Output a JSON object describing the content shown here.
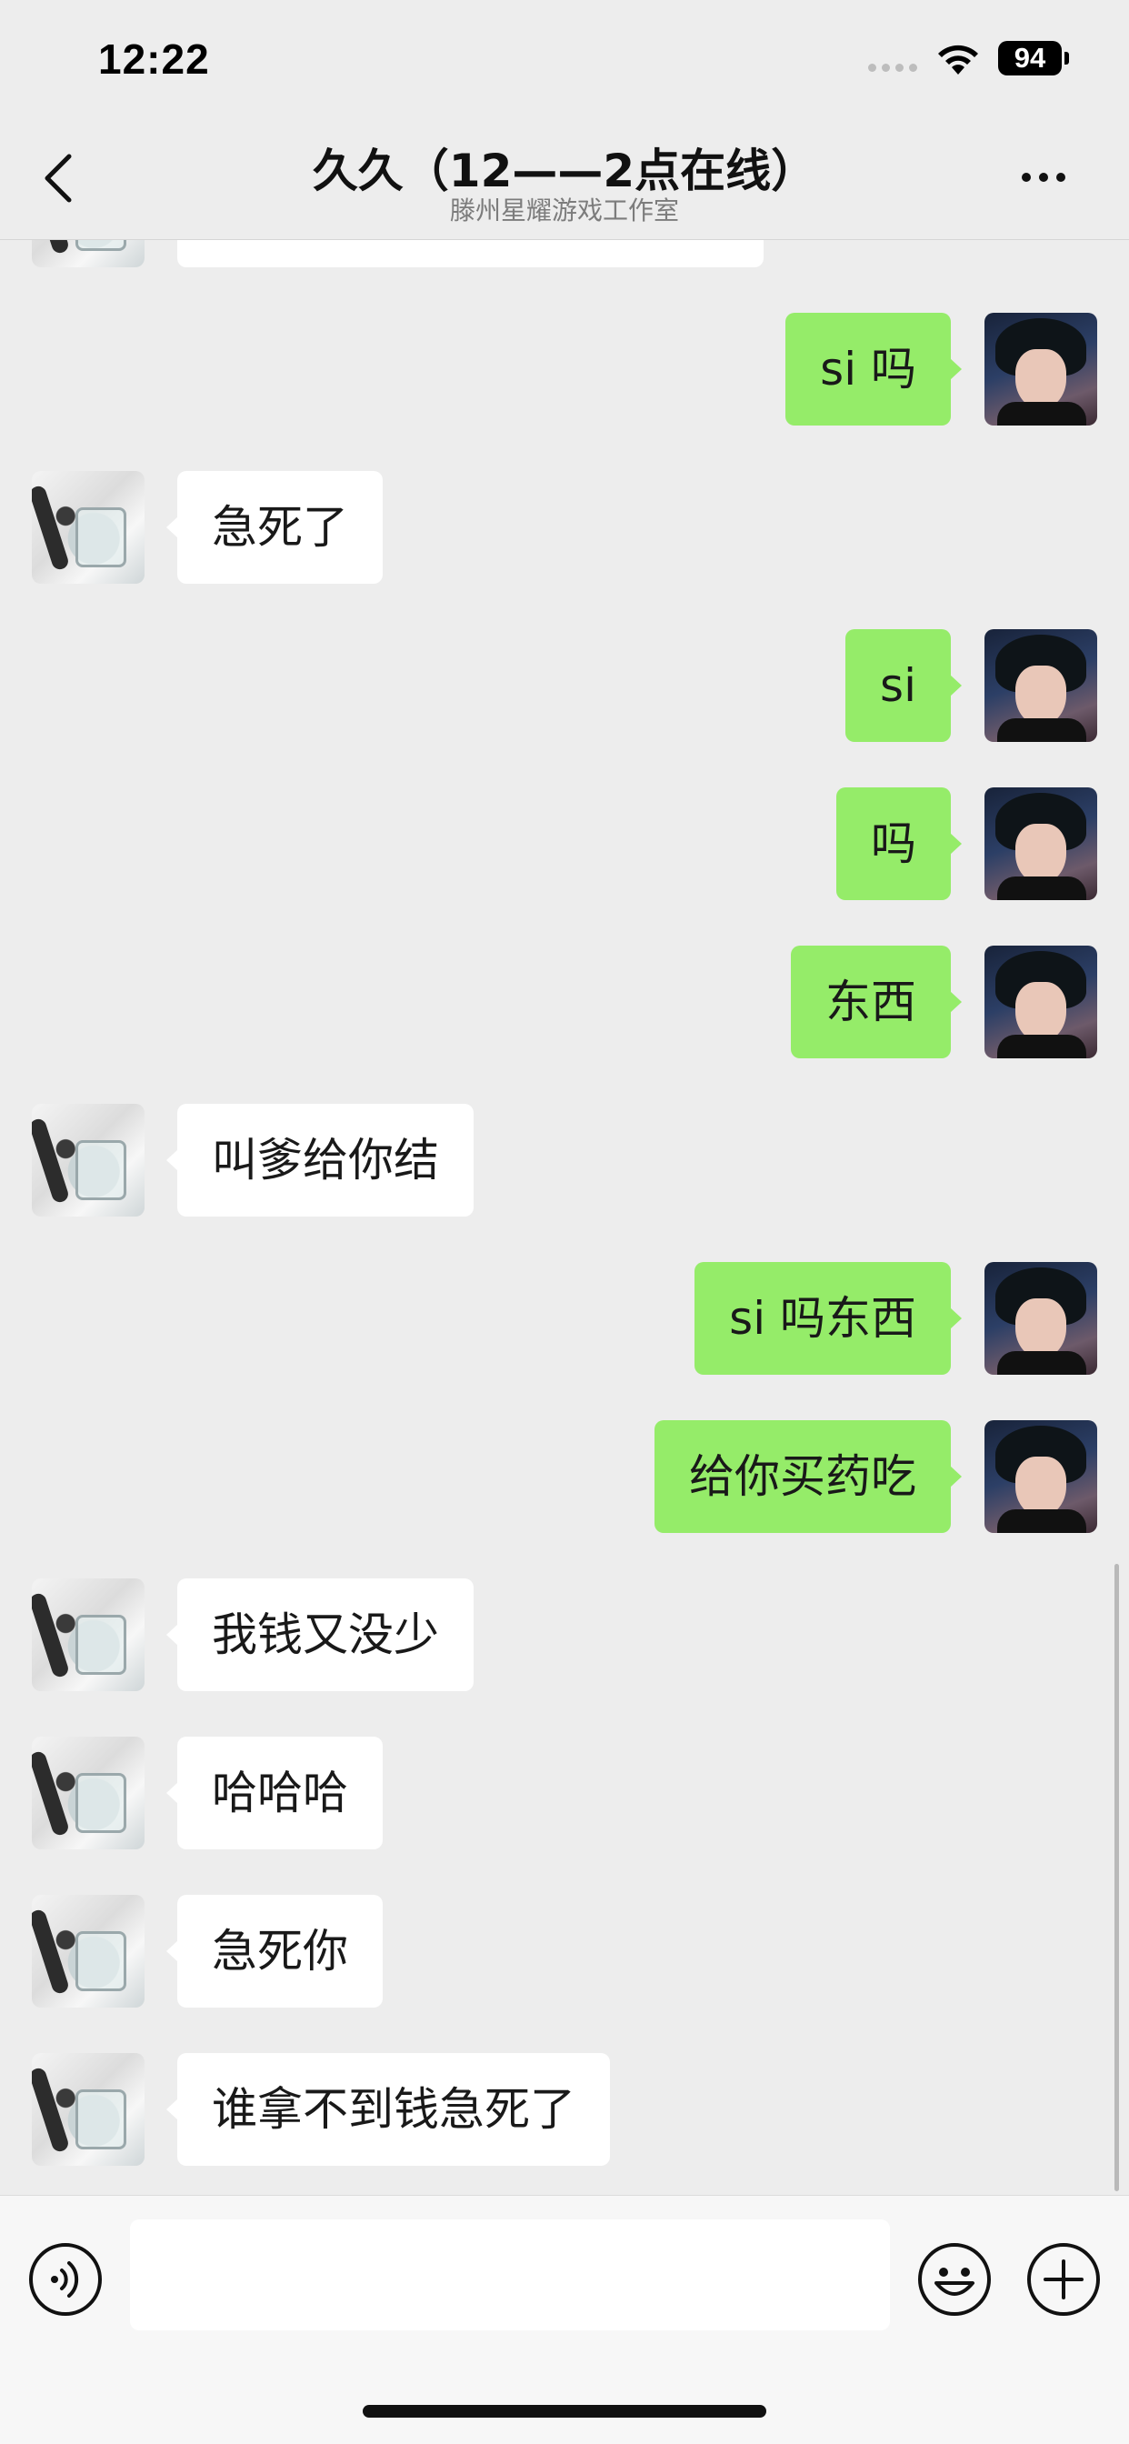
{
  "status_bar": {
    "time": "12:22",
    "battery": "94"
  },
  "header": {
    "title": "久久（12——2点在线）",
    "subtitle": "滕州星耀游戏工作室"
  },
  "messages": [
    {
      "side": "right",
      "text": "si 吗"
    },
    {
      "side": "left",
      "text": "急死了"
    },
    {
      "side": "right",
      "text": "si"
    },
    {
      "side": "right",
      "text": "吗"
    },
    {
      "side": "right",
      "text": "东西"
    },
    {
      "side": "left",
      "text": "叫爹给你结"
    },
    {
      "side": "right",
      "text": "si 吗东西"
    },
    {
      "side": "right",
      "text": "给你买药吃"
    },
    {
      "side": "left",
      "text": "我钱又没少"
    },
    {
      "side": "left",
      "text": "哈哈哈"
    },
    {
      "side": "left",
      "text": "急死你"
    },
    {
      "side": "left",
      "text": "谁拿不到钱急死了"
    }
  ],
  "input": {
    "value": "",
    "placeholder": ""
  },
  "icons": {
    "back": "chevron-left-icon",
    "more": "more-dots-icon",
    "voice": "voice-icon",
    "emoji": "emoji-icon",
    "plus": "plus-circle-icon",
    "wifi": "wifi-icon"
  },
  "colors": {
    "background": "#ededed",
    "sent_bubble": "#95ec69",
    "received_bubble": "#ffffff"
  }
}
